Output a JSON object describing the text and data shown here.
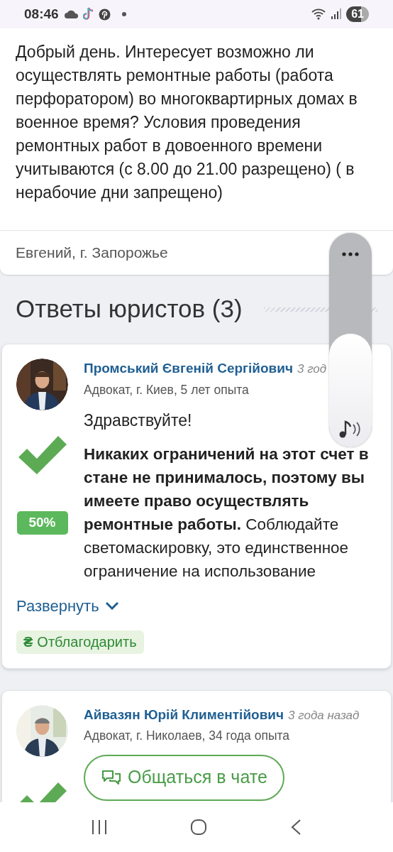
{
  "status_bar": {
    "time": "08:46",
    "battery": "61"
  },
  "question": {
    "text": "Добрый день. Интересует возможно ли осуществлять ремонтные работы (работа перфоратором) во многоквартирных домах в военное время? Условия проведения ремонтных работ в довоенного времени учитываются (с 8.00 до 21.00 разрещено) ( в нерабочие дни запрещено)",
    "author": "Евгений, г. Запорожье"
  },
  "answers_heading": "Ответы юристов (3)",
  "answers": [
    {
      "name": "Промський Євгеній Сергійович",
      "time": "3 год",
      "meta": "Адвокат, г. Киев, 5 лет опыта",
      "greeting": "Здравствуйте!",
      "body": "**Никаких ограничений на этот счет в стане не принималось, поэтому вы имеете право осуществлять ремонтные работы.** Соблюдайте светомаскировку, это единственное ограничение на использование",
      "rating": "50%",
      "expand": "Развернуть",
      "thank_icon": "₴",
      "thank": "Отблагодарить"
    },
    {
      "name": "Айвазян Юрій Климентійович",
      "time": "3 года назад",
      "meta": "Адвокат, г. Николаев, 34 года опыта",
      "chat_button": "Общаться в чате"
    }
  ],
  "volume_panel": {
    "level": 0.53
  }
}
